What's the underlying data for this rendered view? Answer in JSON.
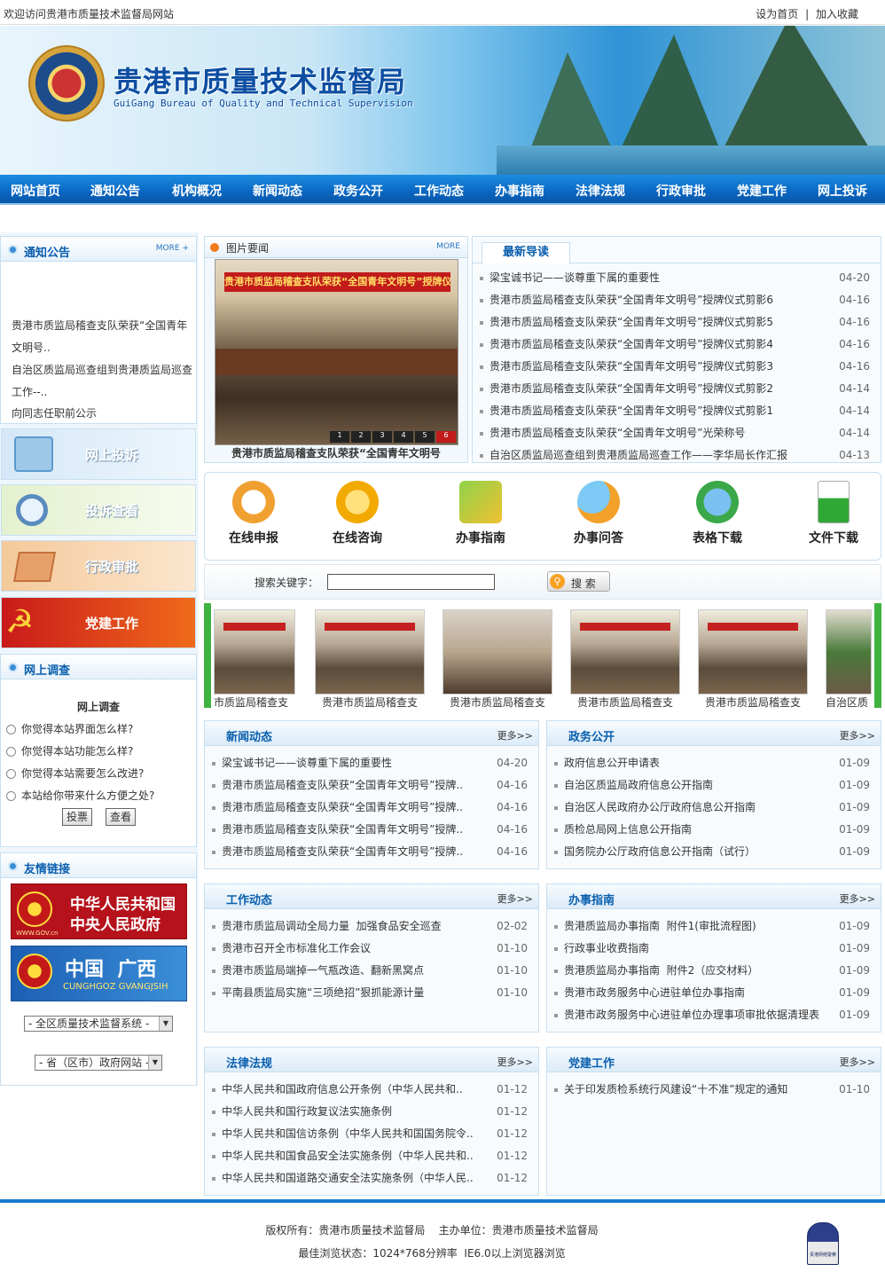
{
  "topbar": {
    "welcome": "欢迎访问贵港市质量技术监督局网站",
    "set_home": "设为首页",
    "divider": "|",
    "bookmark": "加入收藏"
  },
  "header": {
    "title": "贵港市质量技术监督局",
    "subtitle": "GuiGang Bureau of Quality and Technical Supervision"
  },
  "nav": [
    "网站首页",
    "通知公告",
    "机构概况",
    "新闻动态",
    "政务公开",
    "工作动态",
    "办事指南",
    "法律法规",
    "行政审批",
    "党建工作",
    "网上投诉"
  ],
  "notice": {
    "title": "通知公告",
    "more": "MORE +",
    "items": [
      "贵港市质监局稽查支队荣获“全国青年",
      "文明号..",
      "自治区质监局巡查组到贵港质监局巡查",
      "工作--..",
      "向同志任职前公示"
    ]
  },
  "left_buttons": [
    "网上投诉",
    "投诉查看",
    "行政审批",
    "党建工作"
  ],
  "survey": {
    "title": "网上调查",
    "heading": "网上调查",
    "options": [
      "你觉得本站界面怎么样?",
      "你觉得本站功能怎么样?",
      "你觉得本站需要怎么改进?",
      "本站给你带来什么方便之处?"
    ],
    "vote": "投票",
    "view": "查看"
  },
  "links": {
    "title": "友情链接",
    "gov1_line1": "中华人民共和国",
    "gov1_line2": "中央人民政府",
    "gov1_url": "WWW.GOV.cn",
    "gov2_line1": "中国  广西",
    "gov2_line2": "CUNGHGOZ GVANGJSIH",
    "select1": "- 全区质量技术监督系统 -",
    "select2": "- 省（区市）政府网站 -"
  },
  "photo": {
    "title": "图片要闻",
    "more": "MORE",
    "caption": "贵港市质监局稽查支队荣获“全国青年文明号",
    "banner": "贵港市质监局稽查支队荣获“全国青年文明号”授牌仪式",
    "pages": [
      "1",
      "2",
      "3",
      "4",
      "5",
      "6"
    ]
  },
  "latest": {
    "title": "最新导读",
    "items": [
      {
        "t": "梁宝诚书记——谈尊重下属的重要性",
        "d": "04-20"
      },
      {
        "t": "贵港市质监局稽查支队荣获“全国青年文明号”授牌仪式剪影6",
        "d": "04-16"
      },
      {
        "t": "贵港市质监局稽查支队荣获“全国青年文明号”授牌仪式剪影5",
        "d": "04-16"
      },
      {
        "t": "贵港市质监局稽查支队荣获“全国青年文明号”授牌仪式剪影4",
        "d": "04-16"
      },
      {
        "t": "贵港市质监局稽查支队荣获“全国青年文明号”授牌仪式剪影3",
        "d": "04-16"
      },
      {
        "t": "贵港市质监局稽查支队荣获“全国青年文明号”授牌仪式剪影2",
        "d": "04-14"
      },
      {
        "t": "贵港市质监局稽查支队荣获“全国青年文明号”授牌仪式剪影1",
        "d": "04-14"
      },
      {
        "t": "贵港市质监局稽查支队荣获“全国青年文明号”光荣称号",
        "d": "04-14"
      },
      {
        "t": "自治区质监局巡查组到贵港质监局巡查工作——李华局长作汇报",
        "d": "04-13"
      }
    ]
  },
  "services": [
    "在线申报",
    "在线咨询",
    "办事指南",
    "办事问答",
    "表格下载",
    "文件下载"
  ],
  "search": {
    "label": "搜索关键字：",
    "value": "",
    "button": "搜 索"
  },
  "thumbs": [
    "市质监局稽查支",
    "贵港市质监局稽查支",
    "贵港市质监局稽查支",
    "贵港市质监局稽查支",
    "贵港市质监局稽查支",
    "自治区质"
  ],
  "sections": {
    "news": {
      "title": "新闻动态",
      "more": "更多>>",
      "items": [
        {
          "t": "梁宝诚书记——谈尊重下属的重要性",
          "d": "04-20"
        },
        {
          "t": "贵港市质监局稽查支队荣获“全国青年文明号”授牌..",
          "d": "04-16"
        },
        {
          "t": "贵港市质监局稽查支队荣获“全国青年文明号”授牌..",
          "d": "04-16"
        },
        {
          "t": "贵港市质监局稽查支队荣获“全国青年文明号”授牌..",
          "d": "04-16"
        },
        {
          "t": "贵港市质监局稽查支队荣获“全国青年文明号”授牌..",
          "d": "04-16"
        }
      ]
    },
    "gov": {
      "title": "政务公开",
      "more": "更多>>",
      "items": [
        {
          "t": "政府信息公开申请表",
          "d": "01-09"
        },
        {
          "t": "自治区质监局政府信息公开指南",
          "d": "01-09"
        },
        {
          "t": "自治区人民政府办公厅政府信息公开指南",
          "d": "01-09"
        },
        {
          "t": "质检总局网上信息公开指南",
          "d": "01-09"
        },
        {
          "t": "国务院办公厅政府信息公开指南（试行）",
          "d": "01-09"
        }
      ]
    },
    "work": {
      "title": "工作动态",
      "more": "更多>>",
      "items": [
        {
          "t": "贵港市质监局调动全局力量  加强食品安全巡查",
          "d": "02-02"
        },
        {
          "t": "贵港市召开全市标准化工作会议",
          "d": "01-10"
        },
        {
          "t": "贵港市质监局端掉一气瓶改造、翻新黑窝点",
          "d": "01-10"
        },
        {
          "t": "平南县质监局实施“三项绝招”狠抓能源计量",
          "d": "01-10"
        }
      ]
    },
    "guide": {
      "title": "办事指南",
      "more": "更多>>",
      "items": [
        {
          "t": "贵港质监局办事指南  附件1(审批流程图)",
          "d": "01-09"
        },
        {
          "t": "行政事业收费指南",
          "d": "01-09"
        },
        {
          "t": "贵港质监局办事指南  附件2（应交材料）",
          "d": "01-09"
        },
        {
          "t": "贵港市政务服务中心进驻单位办事指南",
          "d": "01-09"
        },
        {
          "t": "贵港市政务服务中心进驻单位办理事项审批依据清理表",
          "d": "01-09"
        }
      ]
    },
    "law": {
      "title": "法律法规",
      "more": "更多>>",
      "items": [
        {
          "t": "中华人民共和国政府信息公开条例（中华人民共和..",
          "d": "01-12"
        },
        {
          "t": "中华人民共和国行政复议法实施条例",
          "d": "01-12"
        },
        {
          "t": "中华人民共和国信访条例（中华人民共和国国务院令..",
          "d": "01-12"
        },
        {
          "t": "中华人民共和国食品安全法实施条例（中华人民共和..",
          "d": "01-12"
        },
        {
          "t": "中华人民共和国道路交通安全法实施条例（中华人民..",
          "d": "01-12"
        }
      ]
    },
    "party": {
      "title": "党建工作",
      "more": "更多>>",
      "items": [
        {
          "t": "关于印发质检系统行风建设“十不准”规定的通知",
          "d": "01-10"
        }
      ]
    }
  },
  "footer": {
    "line1": "版权所有：贵港市质量技术监督局    主办单位：贵港市质量技术监督局",
    "line2": "最佳浏览状态：1024*768分辨率  IE6.0以上浏览器浏览",
    "police": "贵港网络警察"
  },
  "colors": {
    "nav": "#0a67c2",
    "accent": "#0a5fae",
    "border": "#c7dff0"
  }
}
